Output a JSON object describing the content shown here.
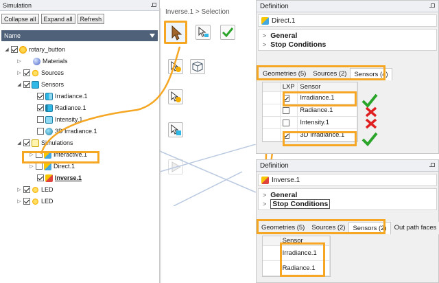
{
  "simulation_panel": {
    "title": "Simulation",
    "buttons": {
      "collapse_all": "Collapse all",
      "expand_all": "Expand all",
      "refresh": "Refresh"
    },
    "tree_header": "Name",
    "tree": [
      {
        "label": "rotary_button",
        "checked": true,
        "icon": "sun-icon"
      },
      {
        "label": "Materials",
        "icon": "sphere-icon"
      },
      {
        "label": "Sources",
        "checked": true,
        "icon": "sources-icon"
      },
      {
        "label": "Sensors",
        "checked": true,
        "icon": "sensors-icon"
      },
      {
        "label": "Irradiance.1",
        "checked": true,
        "icon": "irradiance-sensor-icon"
      },
      {
        "label": "Radiance.1",
        "checked": true,
        "icon": "radiance-sensor-icon"
      },
      {
        "label": "Intensity.1",
        "checked": false,
        "icon": "intensity-sensor-icon"
      },
      {
        "label": "3D Irradiance.1",
        "checked": false,
        "icon": "3d-irradiance-icon"
      },
      {
        "label": "Simulations",
        "checked": true,
        "icon": "simulation-folder-icon"
      },
      {
        "label": "Interactive.1",
        "checked": false,
        "icon": "interactive-sim-icon"
      },
      {
        "label": "Direct.1",
        "checked": false,
        "icon": "direct-sim-icon"
      },
      {
        "label": "Inverse.1",
        "checked": true,
        "icon": "inverse-sim-icon"
      },
      {
        "label": "LED",
        "checked": true,
        "icon": "led-source-icon"
      },
      {
        "label": "LED",
        "checked": true,
        "icon": "led-source-icon"
      }
    ]
  },
  "selection_panel": {
    "breadcrumb": "Inverse.1 > Selection",
    "tools": [
      "select-arrow-icon",
      "select-sensor-icon",
      "validate-check-icon",
      "select-source-icon",
      "select-geometry-icon",
      "select-irradiance-icon",
      "select-cube-icon",
      "play-icon"
    ]
  },
  "definition_top": {
    "title": "Definition",
    "name": "Direct.1",
    "sections": [
      "General",
      "Stop Conditions"
    ],
    "tabs": [
      "Geometries (5)",
      "Sources (2)",
      "Sensors (4)"
    ],
    "columns": [
      "LXP",
      "Sensor"
    ],
    "rows": [
      {
        "lxp": true,
        "sensor": "Irradiance.1",
        "status": "check"
      },
      {
        "lxp": false,
        "sensor": "Radiance.1",
        "status": "cross"
      },
      {
        "lxp": false,
        "sensor": "Intensity.1",
        "status": "cross"
      },
      {
        "lxp": true,
        "sensor": "3D Irradiance.1",
        "status": "check"
      }
    ],
    "colors": {
      "check": "#2aa52a",
      "cross": "#e02020"
    }
  },
  "definition_bottom": {
    "title": "Definition",
    "name": "Inverse.1",
    "sections": [
      "General",
      "Stop Conditions"
    ],
    "tabs": [
      "Geometries (5)",
      "Sources (2)",
      "Sensors (2)",
      "Out path faces"
    ],
    "columns": [
      "Sensor"
    ],
    "rows": [
      "Irradiance.1",
      "Radiance.1"
    ]
  },
  "colors": {
    "highlight": "#f5a623",
    "tree_header": "#4e6178"
  }
}
